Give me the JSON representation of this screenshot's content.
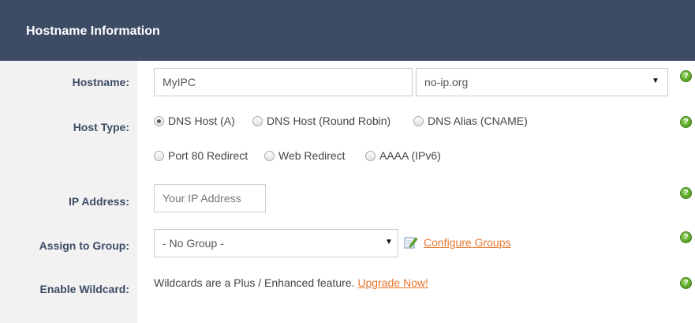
{
  "header": {
    "title": "Hostname Information"
  },
  "labels": {
    "hostname": "Hostname:",
    "host_type": "Host Type:",
    "ip_address": "IP Address:",
    "assign_group": "Assign to Group:",
    "enable_wildcard": "Enable Wildcard:"
  },
  "hostname": {
    "value": "MyIPC",
    "domain": "no-ip.org"
  },
  "host_types": [
    {
      "label": "DNS Host (A)",
      "selected": true
    },
    {
      "label": "DNS Host (Round Robin)",
      "selected": false
    },
    {
      "label": "DNS Alias (CNAME)",
      "selected": false
    },
    {
      "label": "Port 80 Redirect",
      "selected": false
    },
    {
      "label": "Web Redirect",
      "selected": false
    },
    {
      "label": "AAAA (IPv6)",
      "selected": false
    }
  ],
  "ip_address": {
    "placeholder": "Your IP Address"
  },
  "group": {
    "selected": "- No Group -",
    "configure_link": "Configure Groups"
  },
  "wildcard": {
    "text": "Wildcards are a Plus / Enhanced feature.",
    "upgrade_link": "Upgrade Now!"
  },
  "help_glyph": "?",
  "icons": [
    "help-icon",
    "edit-icon",
    "dropdown-arrow-icon"
  ],
  "colors": {
    "header_bg": "#3d4b65",
    "label_col_bg": "#f2f2f2",
    "link": "#e9772f",
    "help_green": "#5ea82a"
  }
}
